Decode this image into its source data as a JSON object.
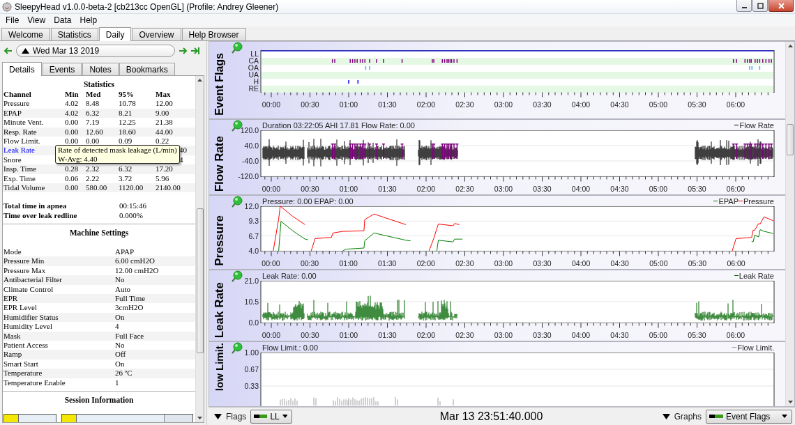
{
  "window": {
    "title": "SleepyHead v1.0.0-beta-2 [cb213cc OpenGL] (Profile: Andrey Gleener)"
  },
  "menu": [
    "File",
    "View",
    "Data",
    "Help"
  ],
  "tabs": [
    {
      "label": "Welcome",
      "selected": false
    },
    {
      "label": "Statistics",
      "selected": false
    },
    {
      "label": "Daily",
      "selected": true
    },
    {
      "label": "Overview",
      "selected": false
    },
    {
      "label": "Help Browser",
      "selected": false
    }
  ],
  "date_nav": {
    "date": "Wed Mar 13 2019"
  },
  "detail_tabs": [
    {
      "label": "Details",
      "selected": true
    },
    {
      "label": "Events",
      "selected": false
    },
    {
      "label": "Notes",
      "selected": false
    },
    {
      "label": "Bookmarks",
      "selected": false
    }
  ],
  "statistics": {
    "title": "Statistics",
    "columns": [
      "Channel",
      "Min",
      "Med",
      "95%",
      "Max"
    ],
    "rows": [
      {
        "channel": "Pressure",
        "link": false,
        "min": "4.02",
        "med": "8.48",
        "p95": "10.78",
        "max": "12.00"
      },
      {
        "channel": "EPAP",
        "link": false,
        "min": "4.02",
        "med": "6.32",
        "p95": "8.21",
        "max": "9.00"
      },
      {
        "channel": "Minute Vent.",
        "link": false,
        "min": "0.00",
        "med": "7.19",
        "p95": "12.25",
        "max": "21.38"
      },
      {
        "channel": "Resp. Rate",
        "link": false,
        "min": "0.00",
        "med": "12.60",
        "p95": "18.60",
        "max": "44.00"
      },
      {
        "channel": "Flow Limit.",
        "link": false,
        "min": "0.00",
        "med": "0.00",
        "p95": "0.09",
        "max": "0.22"
      },
      {
        "channel": "Leak Rate",
        "link": true,
        "max": "40"
      },
      {
        "channel": "Snore",
        "link": false,
        "max": "4"
      },
      {
        "channel": "Insp. Time",
        "link": false,
        "min": "0.28",
        "med": "2.32",
        "p95": "6.32",
        "max": "17.20"
      },
      {
        "channel": "Exp. Time",
        "link": false,
        "min": "0.06",
        "med": "2.22",
        "p95": "3.72",
        "max": "5.96"
      },
      {
        "channel": "Tidal Volume",
        "link": false,
        "min": "0.00",
        "med": "580.00",
        "p95": "1120.00",
        "max": "2140.00"
      }
    ]
  },
  "tooltip": {
    "lines": [
      "Rate of detected mask leakage (L/min)",
      "W-Avg: 4.40"
    ]
  },
  "summary": [
    {
      "label": "Total time in apnea",
      "value": "00:15:46"
    },
    {
      "label": "Time over leak redline",
      "value": "0.000%"
    }
  ],
  "machine_settings": {
    "title": "Machine Settings",
    "rows": [
      {
        "label": "Mode",
        "value": "APAP"
      },
      {
        "label": "Pressure Min",
        "value": "6.00 cmH2O"
      },
      {
        "label": "Pressure Max",
        "value": "12.00 cmH2O"
      },
      {
        "label": "Antibacterial Filter",
        "value": "No"
      },
      {
        "label": "Climate Control",
        "value": "Auto"
      },
      {
        "label": "EPR",
        "value": "Full Time"
      },
      {
        "label": "EPR Level",
        "value": "3cmH2O"
      },
      {
        "label": "Humidifier Status",
        "value": "On"
      },
      {
        "label": "Humidity Level",
        "value": "4"
      },
      {
        "label": "Mask",
        "value": "Full Face"
      },
      {
        "label": "Patient Access",
        "value": "No"
      },
      {
        "label": "Ramp",
        "value": "Off"
      },
      {
        "label": "Smart Start",
        "value": "On"
      },
      {
        "label": "Temperature",
        "value": "26 ºC"
      },
      {
        "label": "Temperature Enable",
        "value": "1"
      }
    ]
  },
  "session_information": {
    "title": "Session Information"
  },
  "graphs": [
    {
      "kind": "flags",
      "title": "Event Flags",
      "rows": [
        {
          "label": "LL"
        },
        {
          "label": "CA",
          "color": "#800080"
        },
        {
          "label": "OA",
          "color": "#40a8ff"
        },
        {
          "label": "UA"
        },
        {
          "label": "H",
          "color": "#0000ff"
        },
        {
          "label": "RE"
        }
      ],
      "x_ticks": [
        "00:00",
        "00:30",
        "01:00",
        "01:30",
        "02:00",
        "02:30",
        "03:00",
        "03:30",
        "04:00",
        "04:30",
        "05:00",
        "05:30",
        "06:00"
      ]
    },
    {
      "kind": "waveform",
      "title": "Flow Rate",
      "info": "Duration 03:22:05 AHI 17.81 Flow Rate: 0.00",
      "legend": [
        {
          "label": "Flow Rate",
          "color": "#000000"
        }
      ],
      "y_ticks": [
        "120.0",
        "40.0",
        "-40.0",
        "-120.0"
      ],
      "x_ticks": [
        "00:00",
        "00:30",
        "01:00",
        "01:30",
        "02:00",
        "02:30",
        "03:00",
        "03:30",
        "04:00",
        "04:30",
        "05:00",
        "05:30",
        "06:00"
      ]
    },
    {
      "kind": "pressure",
      "title": "Pressure",
      "info": "Pressure: 0.00 EPAP: 0.00",
      "chart_data": {
        "type": "line",
        "xlim": [
          -0.13,
          6.49
        ],
        "ylim": [
          4,
          12
        ],
        "yticks": [
          {
            "value": 12,
            "label": "12.0"
          },
          {
            "value": 9.33,
            "label": "9.3"
          },
          {
            "value": 6.67,
            "label": "6.7"
          },
          {
            "value": 4,
            "label": "4.0"
          }
        ],
        "xticks": [
          {
            "value": 0,
            "label": "00:00"
          },
          {
            "value": 0.5,
            "label": "00:30"
          },
          {
            "value": 1,
            "label": "01:00"
          },
          {
            "value": 1.5,
            "label": "01:30"
          },
          {
            "value": 2,
            "label": "02:00"
          },
          {
            "value": 2.5,
            "label": "02:30"
          },
          {
            "value": 3,
            "label": "03:00"
          },
          {
            "value": 3.5,
            "label": "03:30"
          },
          {
            "value": 4,
            "label": "04:00"
          },
          {
            "value": 4.5,
            "label": "04:30"
          },
          {
            "value": 5,
            "label": "05:00"
          },
          {
            "value": 5.5,
            "label": "05:30"
          },
          {
            "value": 6,
            "label": "06:00"
          }
        ],
        "x": [
          0.03,
          0.1,
          0.12,
          0.13,
          0.28,
          0.44,
          0.48,
          0.52,
          0.57,
          0.78,
          0.8,
          0.93,
          0.97,
          1.2,
          1.21,
          1.33,
          1.74,
          1.8,
          2.04,
          2.1,
          2.14,
          2.16,
          2.35,
          2.37,
          2.43,
          2.47,
          5.95,
          6.0,
          6.2,
          6.22,
          6.24,
          6.29,
          6.31,
          6.36,
          6.48
        ],
        "series": [
          {
            "name": "EPAP",
            "color": "#008000",
            "values": [
              null,
              4,
              7.5,
              9.3,
              7.6,
              6.1,
              6.0,
              null,
              null,
              null,
              null,
              4,
              4.3,
              4.5,
              5.8,
              7.2,
              5.9,
              5.8,
              null,
              null,
              4,
              5.9,
              5.6,
              6.1,
              6.1,
              6.1,
              null,
              null,
              5.7,
              5.6,
              6.8,
              6.5,
              7.8,
              7.5,
              7.1
            ]
          },
          {
            "name": "Pressure",
            "color": "#ff0000",
            "values": [
              4,
              9.7,
              12,
              11.9,
              10.2,
              8.7,
              null,
              4,
              6.2,
              6.4,
              7.2,
              7.5,
              7.5,
              7.6,
              9.6,
              10.6,
              8.7,
              null,
              4,
              6.2,
              8,
              8.8,
              8.5,
              8.9,
              8.7,
              null,
              4,
              6.2,
              6.4,
              7.7,
              7.7,
              8.9,
              8.8,
              10.1,
              9.4
            ]
          }
        ]
      }
    },
    {
      "kind": "leak",
      "title": "Leak Rate",
      "info": "Leak Rate: 0.00",
      "legend": [
        {
          "label": "Leak Rate",
          "color": "#006400"
        }
      ],
      "y_ticks": [
        "21.0",
        "10.5",
        "0.0"
      ],
      "x_ticks": [
        "00:00",
        "00:30",
        "01:00",
        "01:30",
        "02:00",
        "02:30",
        "03:00",
        "03:30",
        "04:00",
        "04:30",
        "05:00",
        "05:30",
        "06:00"
      ]
    },
    {
      "kind": "bars",
      "title": "low Limit.",
      "info": "Flow Limit.: 0.00",
      "legend": [
        {
          "label": "Flow Limit.",
          "color": "#a0a0a0"
        }
      ],
      "y_ticks": [
        "1.00",
        "0.67",
        "0.33"
      ]
    }
  ],
  "bottom_bar": {
    "flags_label": "Flags",
    "flag_choice": "LL",
    "time": "Mar 13 23:51:40.000",
    "graphs_label": "Graphs",
    "graph_choice": "Event Flags"
  }
}
